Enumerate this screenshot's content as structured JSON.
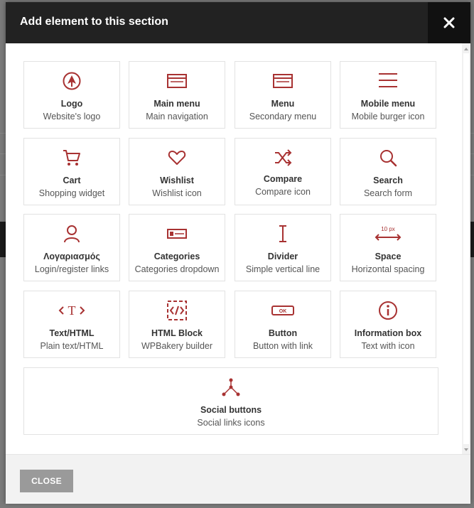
{
  "modal": {
    "title": "Add element to this section",
    "close_icon": "close-icon",
    "close_button_label": "CLOSE"
  },
  "colors": {
    "accent": "#a83232",
    "header_bg": "#222222",
    "close_button_bg": "#9a9a9a"
  },
  "elements": [
    {
      "name": "Logo",
      "desc": "Website's logo",
      "icon": "logo-icon"
    },
    {
      "name": "Main menu",
      "desc": "Main navigation",
      "icon": "main-menu-icon"
    },
    {
      "name": "Menu",
      "desc": "Secondary menu",
      "icon": "menu-icon"
    },
    {
      "name": "Mobile menu",
      "desc": "Mobile burger icon",
      "icon": "mobile-menu-icon"
    },
    {
      "name": "Cart",
      "desc": "Shopping widget",
      "icon": "cart-icon"
    },
    {
      "name": "Wishlist",
      "desc": "Wishlist icon",
      "icon": "heart-icon"
    },
    {
      "name": "Compare",
      "desc": "Compare icon",
      "icon": "shuffle-icon"
    },
    {
      "name": "Search",
      "desc": "Search form",
      "icon": "search-icon"
    },
    {
      "name": "Λογαριασμός",
      "desc": "Login/register links",
      "icon": "user-icon"
    },
    {
      "name": "Categories",
      "desc": "Categories dropdown",
      "icon": "categories-icon"
    },
    {
      "name": "Divider",
      "desc": "Simple vertical line",
      "icon": "divider-icon"
    },
    {
      "name": "Space",
      "desc": "Horizontal spacing",
      "icon": "space-icon",
      "icon_text": "10 px"
    },
    {
      "name": "Text/HTML",
      "desc": "Plain text/HTML",
      "icon": "text-icon",
      "icon_text": "T"
    },
    {
      "name": "HTML Block",
      "desc": "WPBakery builder",
      "icon": "code-block-icon"
    },
    {
      "name": "Button",
      "desc": "Button with link",
      "icon": "button-icon",
      "icon_text": "OK"
    },
    {
      "name": "Information box",
      "desc": "Text with icon",
      "icon": "info-icon"
    },
    {
      "name": "Social buttons",
      "desc": "Social links icons",
      "icon": "share-icon"
    }
  ]
}
